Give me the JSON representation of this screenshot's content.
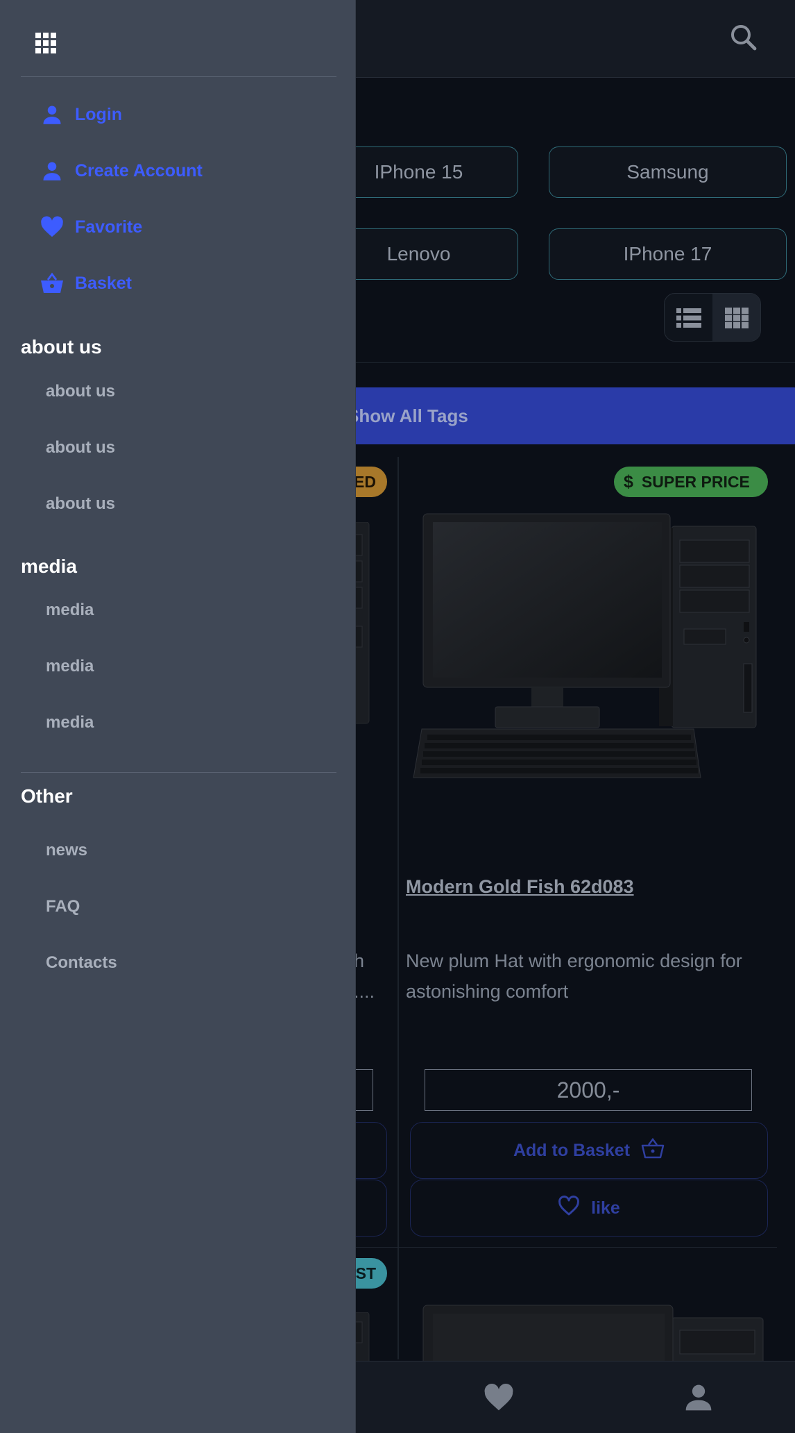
{
  "drawer": {
    "nav": [
      {
        "label": "Login",
        "icon": "person-icon"
      },
      {
        "label": "Create Account",
        "icon": "person-icon"
      },
      {
        "label": "Favorite",
        "icon": "heart-icon"
      },
      {
        "label": "Basket",
        "icon": "basket-icon"
      }
    ],
    "sections": [
      {
        "title": "about us",
        "links": [
          "about us",
          "about us",
          "about us"
        ]
      },
      {
        "title": "media",
        "links": [
          "media",
          "media",
          "media"
        ]
      },
      {
        "title": "Other",
        "links": [
          "news",
          "FAQ",
          "Contacts"
        ]
      }
    ]
  },
  "tags": [
    "IPhone 15",
    "Samsung",
    "Lenovo",
    "IPhone 17"
  ],
  "show_tags_label": "Show All Tags",
  "product": {
    "badge": "SUPER PRICE",
    "badge_left_fragment": "ED",
    "badge_left2_fragment": "ST",
    "title": "Modern Gold Fish 62d083",
    "description": "New plum Hat with ergonomic design for astonishing comfort",
    "left_desc_fragment_1": "h",
    "left_desc_fragment_2": "....",
    "price": "2000,-",
    "add_to_basket": "Add to Basket",
    "like": "like"
  },
  "colors": {
    "accent": "#3d5cff",
    "drawer_bg": "#404856",
    "page_bg": "#0b0f17",
    "super_price": "#3b8c45"
  }
}
